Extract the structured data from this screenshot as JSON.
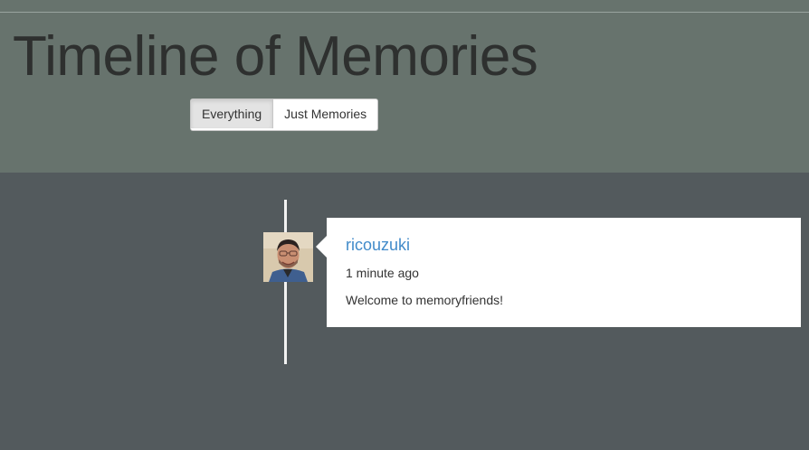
{
  "header": {
    "title": "Timeline of Memories",
    "filters": [
      {
        "label": "Everything",
        "active": true
      },
      {
        "label": "Just Memories",
        "active": false
      }
    ]
  },
  "timeline": {
    "entries": [
      {
        "username": "ricouzuki",
        "time": "1 minute ago",
        "message": "Welcome to memoryfriends!",
        "avatar_icon": "user-avatar-photo"
      }
    ]
  },
  "colors": {
    "header_bg": "#67736d",
    "main_bg": "#535a5d",
    "link": "#428bca"
  }
}
